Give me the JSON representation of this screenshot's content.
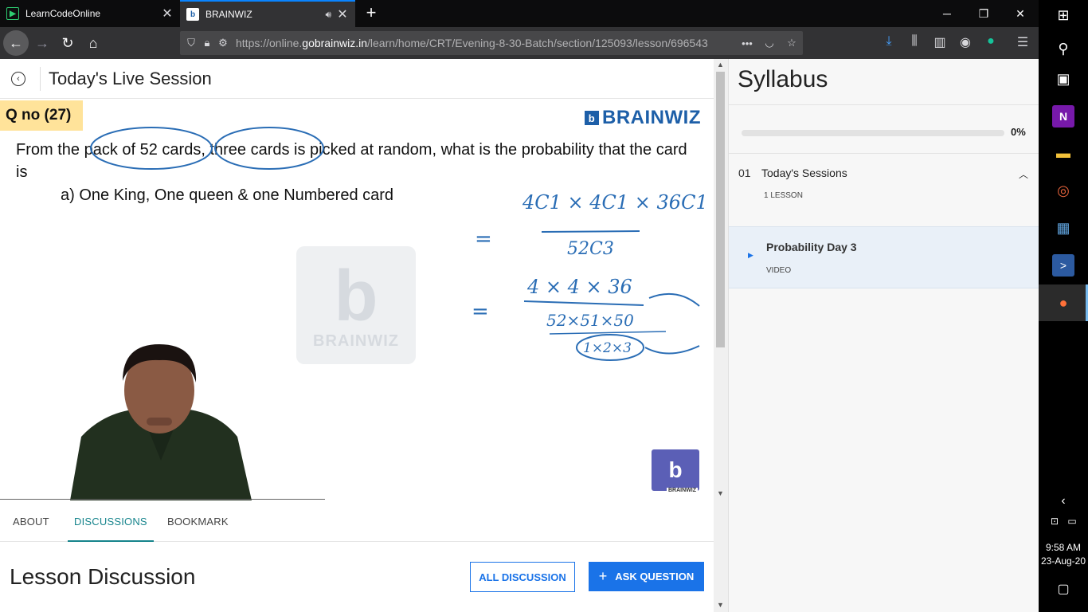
{
  "browser": {
    "tabs": [
      {
        "title": "LearnCodeOnline",
        "favicon": "play-icon",
        "active": false
      },
      {
        "title": "BRAINWIZ",
        "favicon": "brainwiz-icon",
        "active": true
      }
    ],
    "url_prefix": "https://online.",
    "url_domain": "gobrainwiz.in",
    "url_path": "/learn/home/CRT/Evening-8-30-Batch/section/125093/lesson/696543",
    "accent": "#0a84ff"
  },
  "lesson": {
    "header_title": "Today's Live Session",
    "video": {
      "qno": "Q no (27)",
      "brand": "BRAINWIZ",
      "question": "From the pack of 52 cards, three cards is picked at random, what is the probability that the card is",
      "option": "a) One King, One queen & one Numbered card",
      "watermark": "BRAINWIZ",
      "hand_1": "4C1 × 4C1 × 36C1",
      "hand_2": "52C3",
      "hand_3": "4 × 4 × 36",
      "hand_4": "52×51×50",
      "hand_5": "1×2×3",
      "eq": "=",
      "logo_caption": "BRAINWIZ"
    },
    "tabs": [
      "ABOUT",
      "DISCUSSIONS",
      "BOOKMARK"
    ],
    "active_tab": "DISCUSSIONS",
    "discussion_title": "Lesson Discussion",
    "btn_all": "ALL DISCUSSION",
    "btn_ask": "ASK QUESTION"
  },
  "syllabus": {
    "title": "Syllabus",
    "progress_percent": 0,
    "progress_label": "0%",
    "section_num": "01",
    "section_title": "Today's Sessions",
    "section_sub": "1 LESSON",
    "lesson_name": "Probability Day 3",
    "lesson_type": "VIDEO"
  },
  "taskbar": {
    "time": "9:58 AM",
    "date": "23-Aug-20"
  },
  "colors": {
    "teal": "#16848c",
    "blue": "#1a73e8",
    "ink": "#2a6db5"
  }
}
